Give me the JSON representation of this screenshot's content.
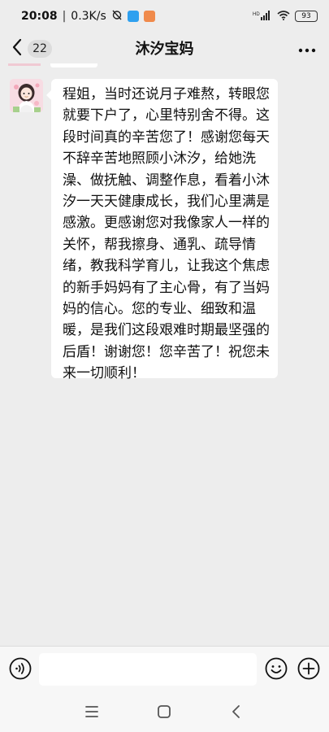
{
  "status": {
    "time": "20:08",
    "network_speed": "0.3K/s",
    "battery": "93",
    "signal_label": "HD"
  },
  "header": {
    "title": "沐汐宝妈",
    "unread_count": "22"
  },
  "message": {
    "text": "程姐，当时还说月子难熬，转眼您就要下户了，心里特别舍不得。这段时间真的辛苦您了！感谢您每天不辞辛苦地照顾小沐汐，给她洗澡、做抚触、调整作息，看着小沐汐一天天健康成长，我们心里满是感激。更感谢您对我像家人一样的关怀，帮我擦身、通乳、疏导情绪，教我科学育儿，让我这个焦虑的新手妈妈有了主心骨，有了当妈妈的信心。您的专业、细致和温暖，是我们这段艰难时期最坚强的后盾！谢谢您！您辛苦了！祝您未来一切顺利！"
  },
  "input": {
    "value": ""
  },
  "colors": {
    "background": "#ededed",
    "bubble": "#ffffff",
    "avatar_bg": "#f7dce3"
  },
  "icons": [
    "back-icon",
    "more-icon",
    "voice-icon",
    "emoji-icon",
    "plus-icon",
    "menu-icon",
    "home-icon",
    "nav-back-icon"
  ]
}
